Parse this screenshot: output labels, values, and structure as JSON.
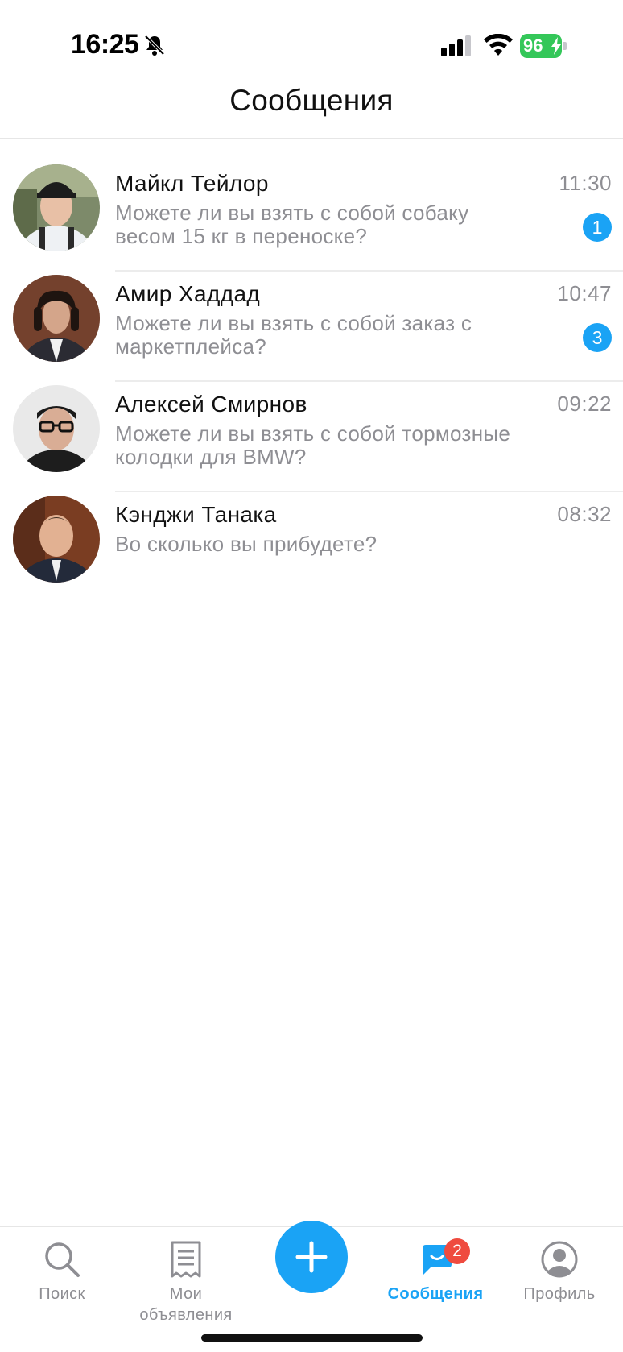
{
  "status_bar": {
    "time": "16:25",
    "battery": "96",
    "icons": [
      "bell-off-icon",
      "signal-icon",
      "wifi-icon",
      "battery-icon"
    ]
  },
  "header": {
    "title": "Сообщения"
  },
  "chats": [
    {
      "name": "Майкл Тейлор",
      "time": "11:30",
      "message": "Можете ли вы взять с собой собаку весом 15 кг в переноске?",
      "unread": "1"
    },
    {
      "name": "Амир Хаддад",
      "time": "10:47",
      "message": "Можете ли вы взять с собой заказ с маркетплейса?",
      "unread": "3"
    },
    {
      "name": "Алексей Смирнов",
      "time": "09:22",
      "message": "Можете ли вы взять с собой тормозные колодки для BMW?",
      "unread": ""
    },
    {
      "name": "Кэнджи Танака",
      "time": "08:32",
      "message": "Во сколько вы прибудете?",
      "unread": ""
    }
  ],
  "tab_bar": {
    "search": "Поиск",
    "my_ads": "Мои\nобъявления",
    "messages": "Сообщения",
    "messages_badge": "2",
    "profile": "Профиль"
  },
  "colors": {
    "accent": "#1aa3f5",
    "badge_red": "#ef4b3f",
    "battery_green": "#34c759",
    "secondary_text": "#8e8e93"
  }
}
